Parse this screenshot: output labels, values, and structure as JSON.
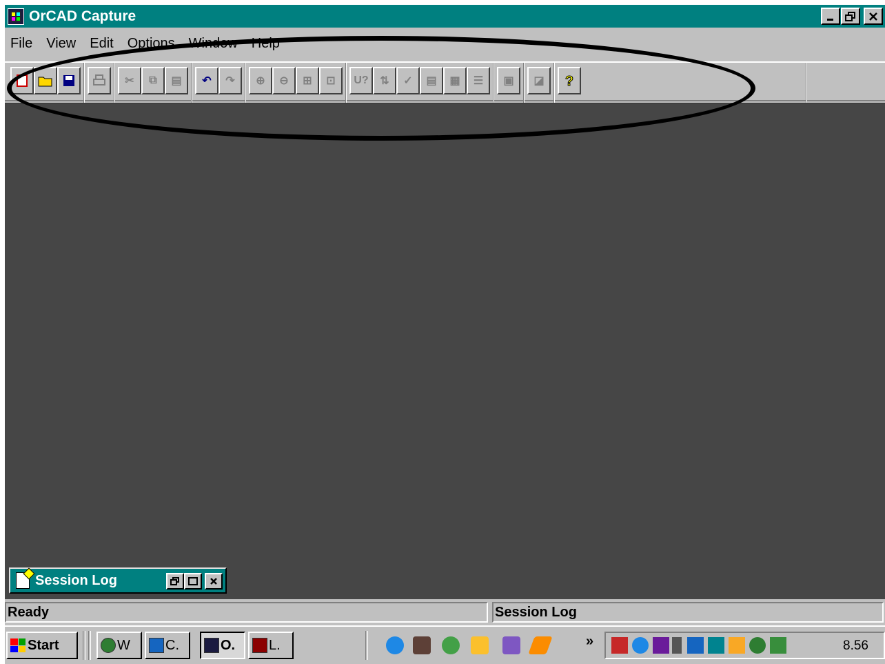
{
  "window": {
    "title": "OrCAD Capture",
    "controls": {
      "minimize": "_",
      "restore": "🗗",
      "close": "✕"
    }
  },
  "menu": [
    "File",
    "View",
    "Edit",
    "Options",
    "Window",
    "Help"
  ],
  "toolbar": {
    "buttons": [
      {
        "name": "new-icon",
        "glyph": "▢"
      },
      {
        "name": "open-icon",
        "glyph": "📂"
      },
      {
        "name": "save-icon",
        "glyph": "💾"
      },
      {
        "name": "print-icon",
        "glyph": "⎙"
      },
      {
        "name": "cut-icon",
        "glyph": "✂"
      },
      {
        "name": "copy-icon",
        "glyph": "⧉"
      },
      {
        "name": "paste-icon",
        "glyph": "📋"
      },
      {
        "name": "undo-icon",
        "glyph": "↶"
      },
      {
        "name": "redo-icon",
        "glyph": "↷"
      },
      {
        "name": "zoom-in-icon",
        "glyph": "⊕"
      },
      {
        "name": "zoom-out-icon",
        "glyph": "⊖"
      },
      {
        "name": "zoom-area-icon",
        "glyph": "⊞"
      },
      {
        "name": "zoom-all-icon",
        "glyph": "⊡"
      },
      {
        "name": "annotate-icon",
        "glyph": "U?"
      },
      {
        "name": "back-annotate-icon",
        "glyph": "⇅"
      },
      {
        "name": "drc-icon",
        "glyph": "✓"
      },
      {
        "name": "netlist-icon",
        "glyph": "▤"
      },
      {
        "name": "cross-reference-icon",
        "glyph": "▦"
      },
      {
        "name": "bill-of-materials-icon",
        "glyph": "☰"
      },
      {
        "name": "project-manager-icon",
        "glyph": "▣"
      },
      {
        "name": "pcb-editor-icon",
        "glyph": "◪"
      },
      {
        "name": "help-icon",
        "glyph": "?"
      }
    ]
  },
  "session_log_window": {
    "title": "Session Log",
    "controls": {
      "restore": "🗗",
      "maximize": "☐",
      "close": "✕"
    }
  },
  "statusbar": {
    "left": "Ready",
    "right": "Session Log"
  },
  "taskbar": {
    "start_label": "Start",
    "tasks": [
      {
        "label": "W",
        "icon_color": "#2e7d32"
      },
      {
        "label": "C.",
        "icon_color": "#1565c0"
      },
      {
        "label": "O.",
        "icon_color": "#1a1a40"
      },
      {
        "label": "L.",
        "icon_color": "#8b0000"
      }
    ],
    "more_glyph": "»",
    "clock": "8.56"
  },
  "colors": {
    "title_bar": "#008080",
    "workspace": "#464646",
    "chrome": "#c0c0c0",
    "annotation": "#000000"
  }
}
